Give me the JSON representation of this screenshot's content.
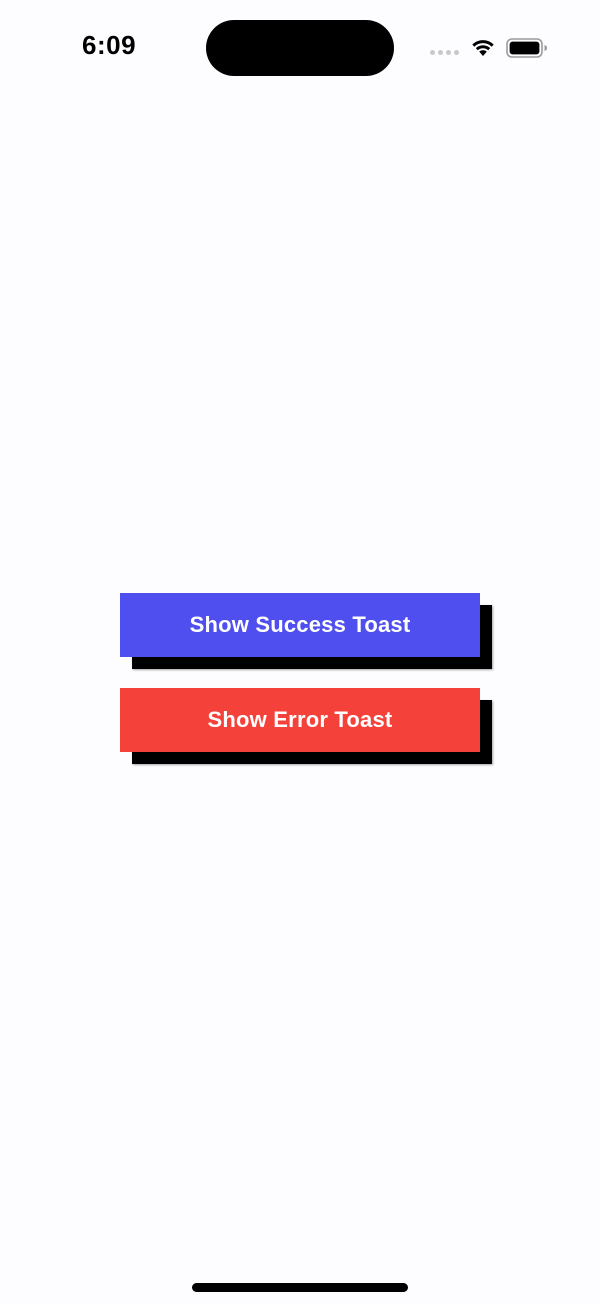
{
  "status_bar": {
    "time": "6:09",
    "icons": [
      "signal-dots-icon",
      "wifi-icon",
      "battery-icon"
    ]
  },
  "main": {
    "success_button": {
      "label": "Show Success Toast",
      "color": "#4f4ff0"
    },
    "error_button": {
      "label": "Show Error Toast",
      "color": "#f4413a"
    },
    "shadow_color": "#000000"
  },
  "background_color": "#fdfcfe"
}
